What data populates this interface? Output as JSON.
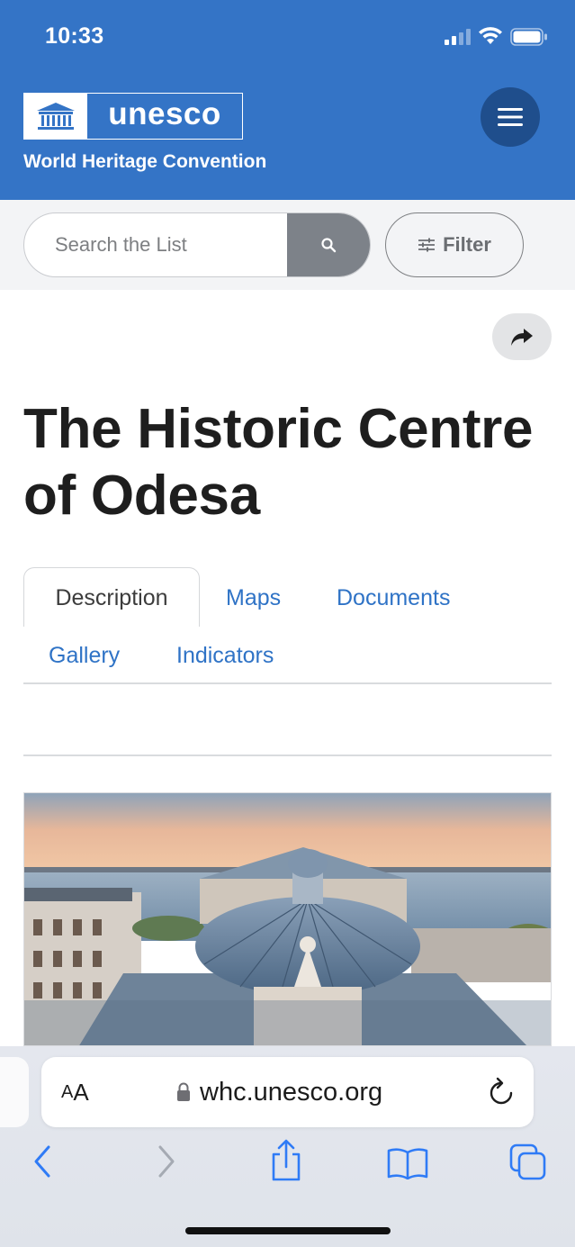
{
  "status_bar": {
    "time": "10:33"
  },
  "header": {
    "logo_text": "unesco",
    "subtitle": "World Heritage Convention",
    "brand_color": "#3474c6",
    "menu_icon": "hamburger-icon"
  },
  "search": {
    "placeholder": "Search the List",
    "button_icon": "search-icon",
    "filter_label": "Filter",
    "filter_icon": "sliders-icon"
  },
  "share_icon": "share-arrow-icon",
  "page_title": "The Historic Centre of Odesa",
  "tabs": [
    {
      "label": "Description",
      "active": true
    },
    {
      "label": "Maps",
      "active": false
    },
    {
      "label": "Documents",
      "active": false
    },
    {
      "label": "Gallery",
      "active": false
    },
    {
      "label": "Indicators",
      "active": false
    }
  ],
  "hero_image": {
    "subject": "Aerial view of Odesa Opera House dome at sunset by the sea"
  },
  "browser": {
    "aa_label": "AA",
    "url": "whc.unesco.org",
    "lock_icon": "lock-icon",
    "reload_icon": "reload-icon",
    "toolbar": [
      "back-icon",
      "forward-icon",
      "share-icon",
      "bookmarks-icon",
      "tabs-icon"
    ]
  }
}
